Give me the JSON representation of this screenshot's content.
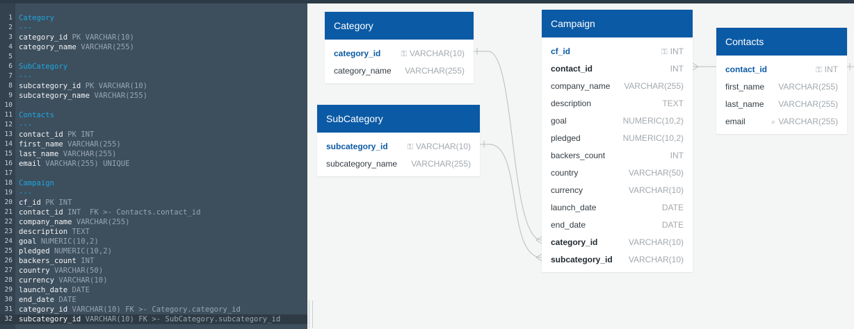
{
  "editor": {
    "lines": [
      {
        "n": "1",
        "parts": [
          {
            "t": "Category",
            "c": "heading"
          }
        ]
      },
      {
        "n": "2",
        "parts": [
          {
            "t": "---",
            "c": "sep"
          }
        ]
      },
      {
        "n": "3",
        "parts": [
          {
            "t": "category_id",
            "c": "name"
          },
          {
            "t": " PK VARCHAR(10)",
            "c": "type"
          }
        ]
      },
      {
        "n": "4",
        "parts": [
          {
            "t": "category_name",
            "c": "name"
          },
          {
            "t": " VARCHAR(255)",
            "c": "type"
          }
        ]
      },
      {
        "n": "5",
        "parts": []
      },
      {
        "n": "6",
        "parts": [
          {
            "t": "SubCategory",
            "c": "heading"
          }
        ]
      },
      {
        "n": "7",
        "parts": [
          {
            "t": "---",
            "c": "sep"
          }
        ]
      },
      {
        "n": "8",
        "parts": [
          {
            "t": "subcategory_id",
            "c": "name"
          },
          {
            "t": " PK VARCHAR(10)",
            "c": "type"
          }
        ]
      },
      {
        "n": "9",
        "parts": [
          {
            "t": "subcategory_name",
            "c": "name"
          },
          {
            "t": " VARCHAR(255)",
            "c": "type"
          }
        ]
      },
      {
        "n": "10",
        "parts": []
      },
      {
        "n": "11",
        "parts": [
          {
            "t": "Contacts",
            "c": "heading"
          }
        ]
      },
      {
        "n": "12",
        "parts": [
          {
            "t": "---",
            "c": "sep"
          }
        ]
      },
      {
        "n": "13",
        "parts": [
          {
            "t": "contact_id",
            "c": "name"
          },
          {
            "t": " PK INT",
            "c": "type"
          }
        ]
      },
      {
        "n": "14",
        "parts": [
          {
            "t": "first_name",
            "c": "name"
          },
          {
            "t": " VARCHAR(255)",
            "c": "type"
          }
        ]
      },
      {
        "n": "15",
        "parts": [
          {
            "t": "last_name",
            "c": "name"
          },
          {
            "t": " VARCHAR(255)",
            "c": "type"
          }
        ]
      },
      {
        "n": "16",
        "parts": [
          {
            "t": "email",
            "c": "name"
          },
          {
            "t": " VARCHAR(255) UNIQUE",
            "c": "type"
          }
        ]
      },
      {
        "n": "17",
        "parts": []
      },
      {
        "n": "18",
        "parts": [
          {
            "t": "Campaign",
            "c": "heading"
          }
        ]
      },
      {
        "n": "19",
        "parts": [
          {
            "t": "---",
            "c": "sep"
          }
        ]
      },
      {
        "n": "20",
        "parts": [
          {
            "t": "cf_id",
            "c": "name"
          },
          {
            "t": " PK INT",
            "c": "type"
          }
        ]
      },
      {
        "n": "21",
        "parts": [
          {
            "t": "contact_id",
            "c": "name"
          },
          {
            "t": " INT  FK >- Contacts.contact_id",
            "c": "type"
          }
        ]
      },
      {
        "n": "22",
        "parts": [
          {
            "t": "company_name",
            "c": "name"
          },
          {
            "t": " VARCHAR(255)",
            "c": "type"
          }
        ]
      },
      {
        "n": "23",
        "parts": [
          {
            "t": "description",
            "c": "name"
          },
          {
            "t": " TEXT",
            "c": "type"
          }
        ]
      },
      {
        "n": "24",
        "parts": [
          {
            "t": "goal",
            "c": "name"
          },
          {
            "t": " NUMERIC(10,2)",
            "c": "type"
          }
        ]
      },
      {
        "n": "25",
        "parts": [
          {
            "t": "pledged",
            "c": "name"
          },
          {
            "t": " NUMERIC(10,2)",
            "c": "type"
          }
        ]
      },
      {
        "n": "26",
        "parts": [
          {
            "t": "backers_count",
            "c": "name"
          },
          {
            "t": " INT",
            "c": "type"
          }
        ]
      },
      {
        "n": "27",
        "parts": [
          {
            "t": "country",
            "c": "name"
          },
          {
            "t": " VARCHAR(50)",
            "c": "type"
          }
        ]
      },
      {
        "n": "28",
        "parts": [
          {
            "t": "currency",
            "c": "name"
          },
          {
            "t": " VARCHAR(10)",
            "c": "type"
          }
        ]
      },
      {
        "n": "29",
        "parts": [
          {
            "t": "launch_date",
            "c": "name"
          },
          {
            "t": " DATE",
            "c": "type"
          }
        ]
      },
      {
        "n": "30",
        "parts": [
          {
            "t": "end_date",
            "c": "name"
          },
          {
            "t": " DATE",
            "c": "type"
          }
        ]
      },
      {
        "n": "31",
        "parts": [
          {
            "t": "category_id",
            "c": "name"
          },
          {
            "t": " VARCHAR(10) FK >- Category.category_id",
            "c": "fk"
          }
        ]
      },
      {
        "n": "32",
        "parts": [
          {
            "t": "subcategory_id",
            "c": "name"
          },
          {
            "t": " VARCHAR(10) FK >- SubCategory.subcategory_id",
            "c": "fk"
          }
        ],
        "active": true
      }
    ]
  },
  "tables": [
    {
      "id": "category",
      "title": "Category",
      "fields": [
        {
          "name": "category_id",
          "type": "VARCHAR(10)",
          "icon": "key-icon",
          "kind": "pk"
        },
        {
          "name": "category_name",
          "type": "VARCHAR(255)"
        }
      ]
    },
    {
      "id": "subcategory",
      "title": "SubCategory",
      "fields": [
        {
          "name": "subcategory_id",
          "type": "VARCHAR(10)",
          "icon": "key-icon",
          "kind": "pk"
        },
        {
          "name": "subcategory_name",
          "type": "VARCHAR(255)"
        }
      ]
    },
    {
      "id": "campaign",
      "title": "Campaign",
      "fields": [
        {
          "name": "cf_id",
          "type": "INT",
          "icon": "key-icon",
          "kind": "pk"
        },
        {
          "name": "contact_id",
          "type": "INT",
          "kind": "fk"
        },
        {
          "name": "company_name",
          "type": "VARCHAR(255)"
        },
        {
          "name": "description",
          "type": "TEXT"
        },
        {
          "name": "goal",
          "type": "NUMERIC(10,2)"
        },
        {
          "name": "pledged",
          "type": "NUMERIC(10,2)"
        },
        {
          "name": "backers_count",
          "type": "INT"
        },
        {
          "name": "country",
          "type": "VARCHAR(50)"
        },
        {
          "name": "currency",
          "type": "VARCHAR(10)"
        },
        {
          "name": "launch_date",
          "type": "DATE"
        },
        {
          "name": "end_date",
          "type": "DATE"
        },
        {
          "name": "category_id",
          "type": "VARCHAR(10)",
          "kind": "fk"
        },
        {
          "name": "subcategory_id",
          "type": "VARCHAR(10)",
          "kind": "fk"
        }
      ]
    },
    {
      "id": "contacts",
      "title": "Contacts",
      "fields": [
        {
          "name": "contact_id",
          "type": "INT",
          "icon": "key-icon",
          "kind": "pk"
        },
        {
          "name": "first_name",
          "type": "VARCHAR(255)"
        },
        {
          "name": "last_name",
          "type": "VARCHAR(255)"
        },
        {
          "name": "email",
          "type": "VARCHAR(255)",
          "icon": "unique-icon"
        }
      ]
    }
  ],
  "colors": {
    "accent": "#0b5aa5",
    "editor_bg": "#3d4e5c",
    "heading": "#1ea7e1",
    "connector": "#b8bcc0"
  }
}
